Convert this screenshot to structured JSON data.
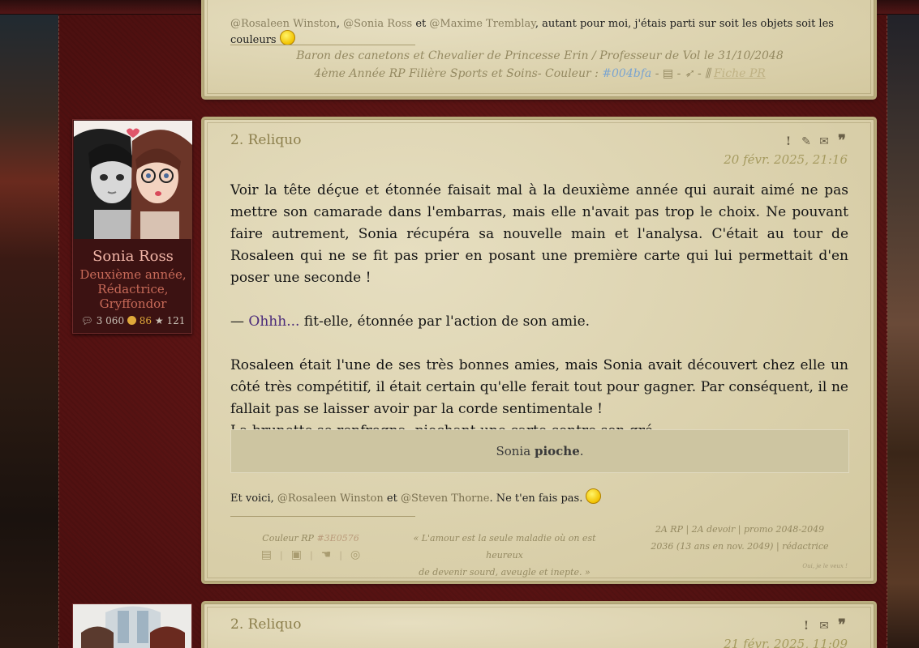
{
  "top_post": {
    "mentions": {
      "prefix": "@Rosaleen Winston",
      "sep1": ", ",
      "mention2": "@Sonia Ross",
      "sep2": " et ",
      "mention3": "@Maxime Tremblay",
      "text": ", autant pour moi, j'étais parti sur soit les objets soit les couleurs "
    },
    "signature": {
      "line1": "Baron des canetons et Chevalier de Princesse Erin / Professeur de Vol le 31/10/2048",
      "line2_prefix": "4ème Année RP Filière Sports et Soins- Couleur : ",
      "color_code": "#004bfa",
      "fiche": "Fiche PR"
    }
  },
  "post": {
    "title": "2. Reliquo",
    "date": "20 févr. 2025, 21:16",
    "paragraphs": {
      "p1": "Voir la tête déçue et étonnée faisait mal à la deuxième année qui aurait aimé ne pas mettre son camarade dans l'embarras, mais elle n'avait pas trop le choix. Ne pouvant faire autrement, Sonia récupéra sa nouvelle main et l'analysa. C'était au tour de Rosaleen qui ne se fit pas prier en posant une première carte qui lui permettait d'en poser une seconde !",
      "p2_dash": "— ",
      "p2_accent": "Ohhh...",
      "p2_rest": " fit-elle, étonnée par l'action de son amie.",
      "p3": "Rosaleen était l'une de ses très bonnes amies, mais Sonia avait découvert chez elle un côté très compétitif, il était certain qu'elle ferait tout pour gagner. Par conséquent, il ne fallait pas se laisser avoir par la corde sentimentale !",
      "p4": "La brunette se renfrogna, piochant une carte contre son gré."
    },
    "dice": {
      "name": "Sonia",
      "action": "pioche"
    },
    "mentions": {
      "prefix": "Et voici, ",
      "mention1": "@Rosaleen Winston",
      "sep": " et ",
      "mention2": "@Steven Thorne",
      "suffix": ". Ne t'en fais pas. "
    },
    "signature": {
      "color_label": "Couleur RP ",
      "color_code": "#3E0576",
      "quote_line1": "« L'amour est la seule maladie où on est heureux",
      "quote_line2": "de devenir sourd, aveugle et inepte. »",
      "info_line1": "2A RP | 2A devoir | promo 2048-2049",
      "info_line2": "2036 (13 ans en nov. 2049) | rédactrice",
      "tiny": "Oui, je le veux !"
    }
  },
  "profile": {
    "name": "Sonia Ross",
    "role": "Deuxième année, Rédactrice, Gryffondor",
    "messages": "3 060",
    "coins": "86",
    "reputation": "121"
  },
  "next_post": {
    "title": "2. Reliquo",
    "date": "21 févr. 2025, 11:09"
  },
  "colors": {
    "wall": "#5a1414",
    "panel": "#dcd3b0",
    "profile_name": "#f2b6a8",
    "profile_role": "#c76a58",
    "accent": "#4a2a7a"
  }
}
